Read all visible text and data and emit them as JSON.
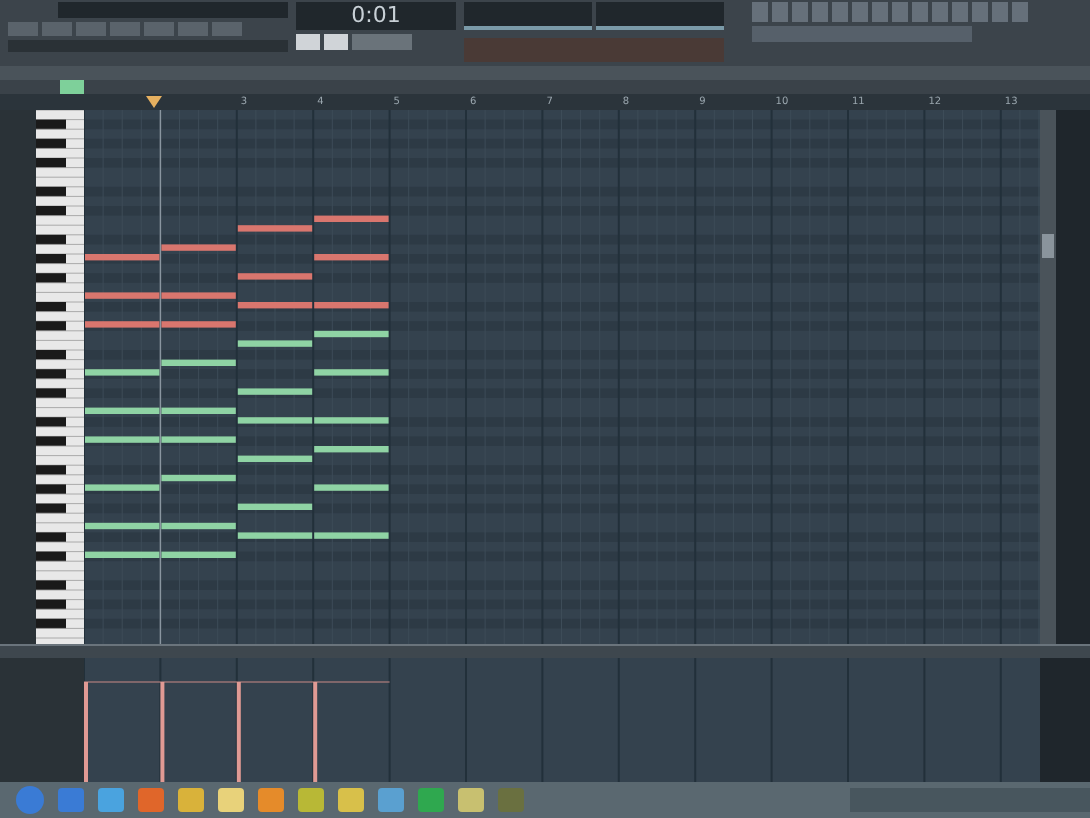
{
  "transport": {
    "time": "0:01"
  },
  "ruler": {
    "labels": [
      "3",
      "4",
      "5",
      "6",
      "7",
      "8",
      "9",
      "10",
      "11",
      "12",
      "13"
    ]
  },
  "notes": [
    {
      "color": "#d9766e"
    },
    {
      "color": "#d9766e"
    },
    {
      "color": "#d9766e"
    },
    {
      "color": "#8fd3a4"
    },
    {
      "color": "#8fd3a4"
    },
    {
      "color": "#8fd3a4"
    },
    {
      "color": "#8fd3a4"
    },
    {
      "color": "#8fd3a4"
    },
    {
      "color": "#8fd3a4"
    },
    {
      "color": "#d9766e"
    },
    {
      "color": "#d9766e"
    },
    {
      "color": "#d9766e"
    },
    {
      "color": "#8fd3a4"
    },
    {
      "color": "#8fd3a4"
    },
    {
      "color": "#8fd3a4"
    },
    {
      "color": "#8fd3a4"
    },
    {
      "color": "#8fd3a4"
    },
    {
      "color": "#8fd3a4"
    },
    {
      "color": "#d9766e"
    },
    {
      "color": "#d9766e"
    },
    {
      "color": "#d9766e"
    },
    {
      "color": "#8fd3a4"
    },
    {
      "color": "#8fd3a4"
    },
    {
      "color": "#8fd3a4"
    },
    {
      "color": "#8fd3a4"
    },
    {
      "color": "#8fd3a4"
    },
    {
      "color": "#8fd3a4"
    },
    {
      "color": "#d9766e"
    },
    {
      "color": "#d9766e"
    },
    {
      "color": "#d9766e"
    },
    {
      "color": "#8fd3a4"
    },
    {
      "color": "#8fd3a4"
    },
    {
      "color": "#8fd3a4"
    },
    {
      "color": "#8fd3a4"
    },
    {
      "color": "#8fd3a4"
    },
    {
      "color": "#8fd3a4"
    }
  ]
}
